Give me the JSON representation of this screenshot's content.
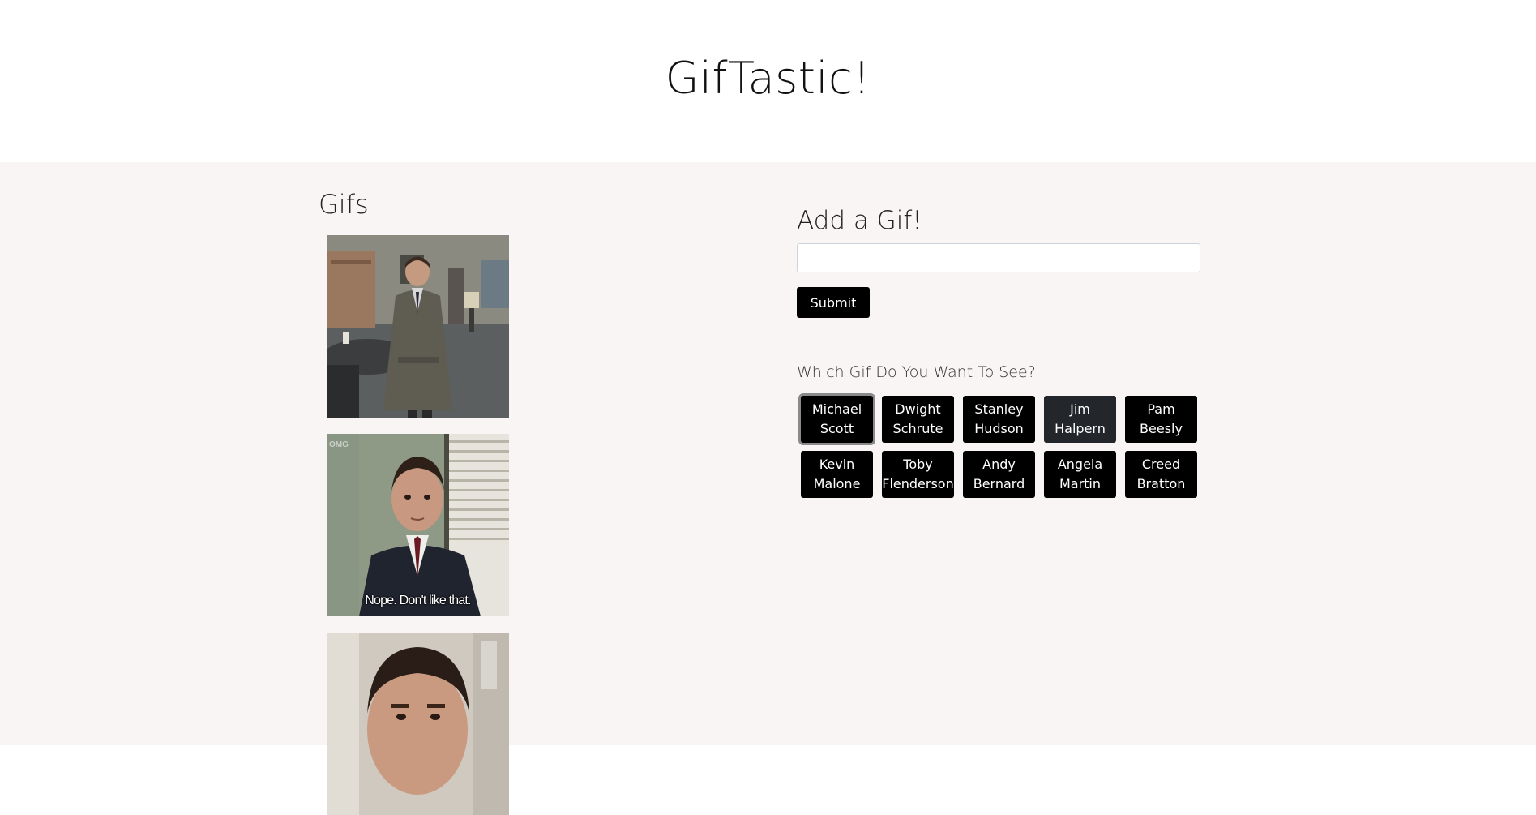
{
  "header": {
    "title": "GifTastic!"
  },
  "gifs": {
    "heading": "Gifs",
    "items": [
      {
        "caption": "",
        "watermark": ""
      },
      {
        "caption": "Nope. Don't like that.",
        "watermark": "OMG"
      },
      {
        "caption": "",
        "watermark": ""
      }
    ]
  },
  "add_form": {
    "heading": "Add a Gif!",
    "input_value": "",
    "input_placeholder": "",
    "submit_label": "Submit"
  },
  "choices": {
    "label": "Which Gif Do You Want To See?",
    "buttons": [
      {
        "line1": "Michael",
        "line2": "Scott",
        "state": "active"
      },
      {
        "line1": "Dwight",
        "line2": "Schrute",
        "state": "normal"
      },
      {
        "line1": "Stanley",
        "line2": "Hudson",
        "state": "normal"
      },
      {
        "line1": "Jim",
        "line2": "Halpern",
        "state": "hover"
      },
      {
        "line1": "Pam",
        "line2": "Beesly",
        "state": "normal"
      },
      {
        "line1": "Kevin",
        "line2": "Malone",
        "state": "normal"
      },
      {
        "line1": "Toby",
        "line2": "Flenderson",
        "state": "normal"
      },
      {
        "line1": "Andy",
        "line2": "Bernard",
        "state": "normal"
      },
      {
        "line1": "Angela",
        "line2": "Martin",
        "state": "normal"
      },
      {
        "line1": "Creed",
        "line2": "Bratton",
        "state": "normal"
      }
    ]
  },
  "colors": {
    "page_background": "#f9f5f4",
    "header_background": "#ffffff",
    "button_background": "#000000",
    "button_text": "#ffffff"
  }
}
